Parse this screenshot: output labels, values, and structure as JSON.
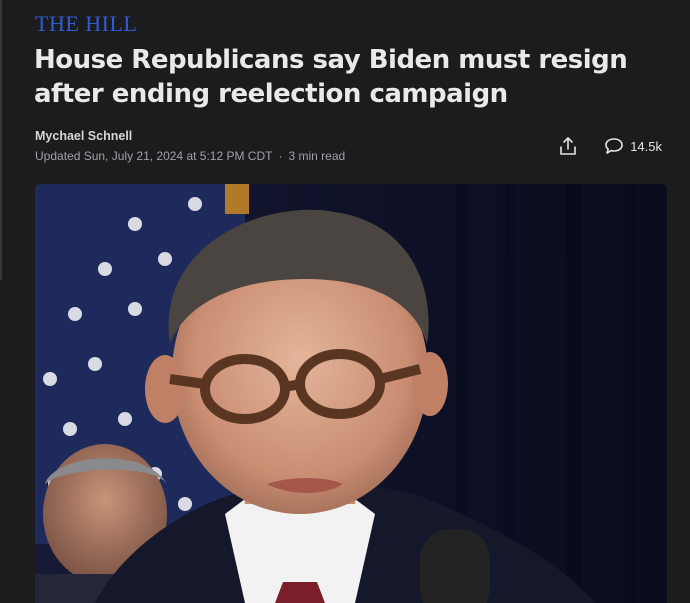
{
  "publication": {
    "logo_text": "THE HILL"
  },
  "article": {
    "headline": "House Republicans say Biden must resign after ending reelection campaign",
    "author": "Mychael Schnell",
    "updated": "Updated Sun, July 21, 2024 at 5:12 PM CDT",
    "separator": "·",
    "read_time": "3 min read"
  },
  "actions": {
    "share_icon": "share-icon",
    "comments_icon": "comment-bubble-icon",
    "comments_count": "14.5k"
  },
  "hero_image": {
    "description_icon": "photo",
    "colors": {
      "backdrop": "#0f1226",
      "flag_blue": "#1f2a5c",
      "flag_red": "#a63a3a"
    }
  },
  "colors": {
    "background": "#1c1c1e",
    "logo": "#2f5bd3",
    "headline": "#e9e9ea",
    "meta": "#a1a1a6"
  }
}
